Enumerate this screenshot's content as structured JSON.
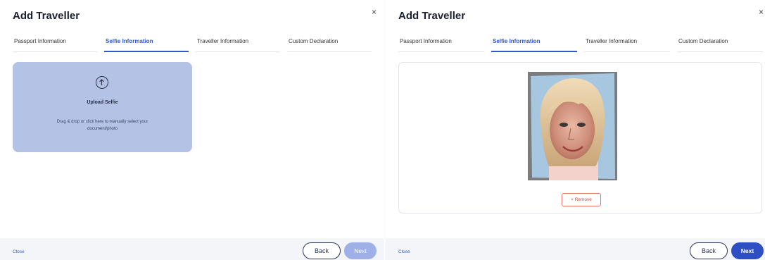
{
  "colors": {
    "accent": "#2f55c8",
    "upload_zone": "#b4c2e6",
    "danger": "#d9473c",
    "next_disabled": "#9db0e8"
  },
  "icons": {
    "close": "close-icon",
    "upload": "upload-arrow-icon",
    "remove": "x-icon"
  },
  "left": {
    "title": "Add Traveller",
    "close_glyph": "×",
    "tabs": [
      {
        "label": "Passport Information",
        "active": false
      },
      {
        "label": "Selfie Information",
        "active": true
      },
      {
        "label": "Traveller Information",
        "active": false
      },
      {
        "label": "Custom Declaration",
        "active": false
      }
    ],
    "upload": {
      "title": "Upload Selfie",
      "description": "Drag & drop or click here to manually select your document/photo"
    },
    "footer": {
      "close": "Close",
      "back": "Back",
      "next": "Next"
    }
  },
  "right": {
    "title": "Add Traveller",
    "close_glyph": "×",
    "tabs": [
      {
        "label": "Passport Information",
        "active": false
      },
      {
        "label": "Selfie Information",
        "active": true
      },
      {
        "label": "Traveller Information",
        "active": false
      },
      {
        "label": "Custom Declaration",
        "active": false
      }
    ],
    "preview": {
      "remove_label": "Remove",
      "remove_glyph": "×"
    },
    "footer": {
      "close": "Close",
      "back": "Back",
      "next": "Next"
    }
  }
}
